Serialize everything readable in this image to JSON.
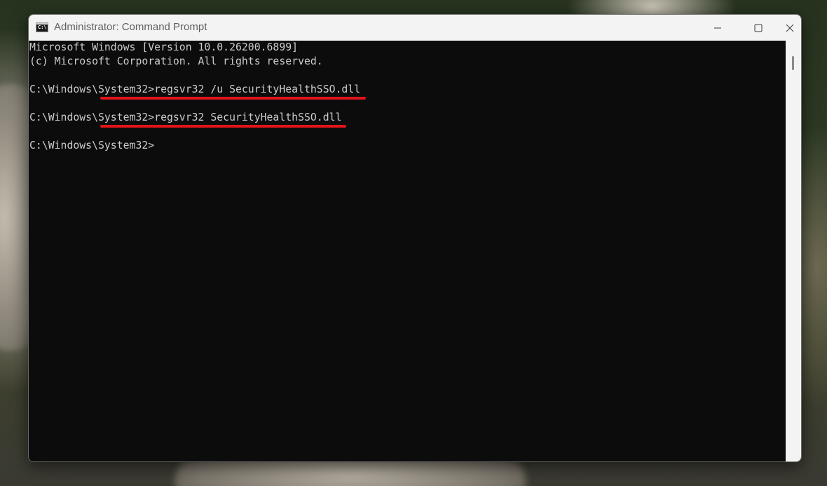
{
  "window": {
    "title": "Administrator: Command Prompt",
    "icon": "command-prompt-icon",
    "icon_glyph": "C:\\"
  },
  "controls": {
    "minimize_icon": "minimize-icon",
    "maximize_icon": "maximize-icon",
    "close_icon": "close-icon"
  },
  "terminal": {
    "lines": [
      "Microsoft Windows [Version 10.0.26200.6899]",
      "(c) Microsoft Corporation. All rights reserved.",
      "C:\\Windows\\System32>regsvr32 /u SecurityHealthSSO.dll",
      "C:\\Windows\\System32>regsvr32 SecurityHealthSSO.dll",
      "C:\\Windows\\System32>"
    ],
    "text_color": "#cccccc",
    "background_color": "#0c0c0c"
  },
  "annotations": {
    "underline_color": "#e0141a"
  }
}
